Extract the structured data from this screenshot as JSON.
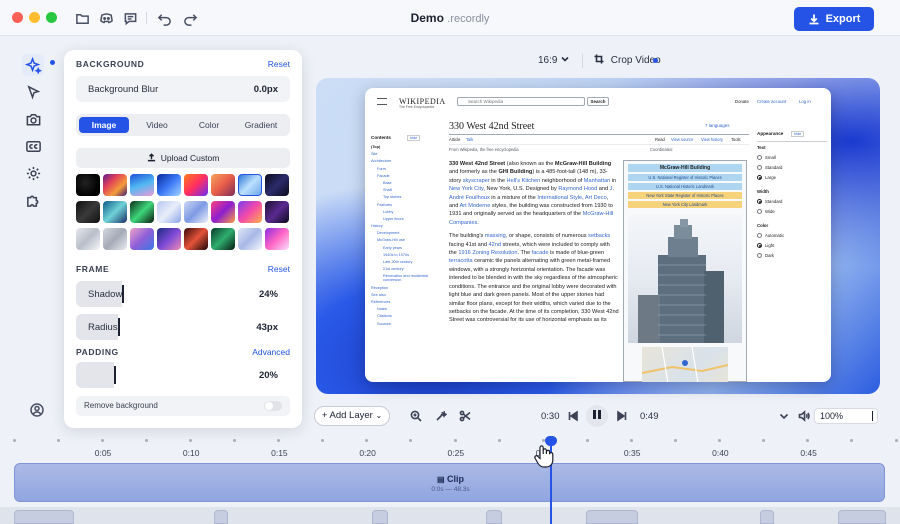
{
  "window": {
    "title": "Demo",
    "extension": ".recordly",
    "export_label": "Export"
  },
  "panel": {
    "background_section": "BACKGROUND",
    "background_reset": "Reset",
    "blur_label": "Background Blur",
    "blur_value": "0.0px",
    "tabs": [
      "Image",
      "Video",
      "Color",
      "Gradient"
    ],
    "active_tab": "Image",
    "upload_label": "Upload Custom",
    "frame_section": "FRAME",
    "frame_reset": "Reset",
    "shadow_label": "Shadow",
    "shadow_value": "24%",
    "shadow_level": 0.24,
    "radius_label": "Radius",
    "radius_value": "43px",
    "padding_section": "PADDING",
    "padding_advanced": "Advanced",
    "padding_value": "20%",
    "padding_level": 0.2,
    "remove_bg_label": "Remove background"
  },
  "canvas_toolbar": {
    "aspect_ratio": "16:9",
    "crop_label": "Crop Video"
  },
  "wiki": {
    "logo": "WIKIPEDIA",
    "tagline": "The Free Encyclopedia",
    "search_placeholder": "Search Wikipedia",
    "search_button": "Search",
    "top_links": [
      "Donate",
      "Create account",
      "Log in"
    ],
    "title": "330 West 42nd Street",
    "languages": "7 languages",
    "tabs": [
      "Article",
      "Talk"
    ],
    "actions": [
      "Read",
      "View source",
      "View history",
      "Tools"
    ],
    "from": "From Wikipedia, the free encyclopedia",
    "coordinates_label": "Coordinates:",
    "contents_title": "Contents",
    "contents_hide": "hide",
    "toc": [
      "(Top)",
      "Site",
      "Architecture",
      "Form",
      "Facade",
      "Base",
      "Shaft",
      "Top stories",
      "Features",
      "Lobby",
      "Upper floors",
      "History",
      "Development",
      "McGraw-Hill use",
      "Early years",
      "1940s to 1970s",
      "Late 20th century",
      "21st century",
      "Renovation and residential conversion",
      "Reception",
      "See also",
      "References",
      "Notes",
      "Citations",
      "Sources"
    ],
    "body_p1_a": "330 West 42nd Street",
    "body_p1_b": " (also known as the ",
    "body_p1_c": "McGraw-Hill Building",
    "body_p1_d": " and formerly as the ",
    "body_p1_e": "GHI Building",
    "body_p1_f": ") is a 485-foot-tall (148 m), 33-story ",
    "body_p1_g": "skyscraper",
    "body_p1_h": " in the ",
    "body_p1_i": "Hell's Kitchen",
    "body_p1_j": " neighborhood of ",
    "body_p1_k": "Manhattan",
    "body_p1_l": " in ",
    "body_p1_m": "New York City",
    "body_p1_n": ", New York, U.S. Designed by ",
    "body_p1_o": "Raymond Hood",
    "body_p1_p": " and ",
    "body_p1_q": "J. André Fouilhoux",
    "body_p1_r": " in a mixture of the ",
    "body_p1_s": "International Style",
    "body_p1_t": ", ",
    "body_p1_u": "Art Deco",
    "body_p1_v": ", and ",
    "body_p1_w": "Art Moderne",
    "body_p1_x": " styles, the building was constructed from 1930 to 1931 and originally served as the headquarters of the ",
    "body_p1_y": "McGraw-Hill Companies",
    "body_p1_z": ".",
    "body_p2_a": "The building's ",
    "body_p2_b": "massing",
    "body_p2_c": ", or shape, consists of numerous ",
    "body_p2_d": "setbacks",
    "body_p2_e": " facing 41st and ",
    "body_p2_f": "42nd",
    "body_p2_g": " streets, which were included to comply with the ",
    "body_p2_h": "1916 Zoning Resolution",
    "body_p2_i": ". The ",
    "body_p2_j": "facade",
    "body_p2_k": " is made of blue-green ",
    "body_p2_l": "terracotta",
    "body_p2_m": " ceramic tile panels alternating with green metal-framed windows, with a strongly horizontal orientation. The facade was intended to be blended in with the sky regardless of the atmospheric conditions. The entrance and the original lobby were decorated with light blue and dark green panels. Most of the upper stories had similar floor plans, except for their widths, which varied due to the setbacks on the facade. At the time of its completion, 330 West 42nd Street was controversial for its use of horizontal emphasis as its",
    "infobox_title": "McGraw-Hill Building",
    "infobox_rows": [
      "U.S. National Register of Historic Places",
      "U.S. National Historic Landmark",
      "New York State Register of Historic Places",
      "New York City Landmark"
    ],
    "appearance_title": "Appearance",
    "appearance_hide": "hide",
    "text_label": "Text",
    "text_options": [
      "Small",
      "Standard",
      "Large"
    ],
    "width_label": "Width",
    "width_options": [
      "Standard",
      "Wide"
    ],
    "color_label": "Color",
    "color_options": [
      "Automatic",
      "Light",
      "Dark"
    ]
  },
  "playback": {
    "add_layer": "Add Layer",
    "current_time": "0:30",
    "total_time": "0:49",
    "zoom": "100%"
  },
  "timeline": {
    "ruler": [
      "0:05",
      "0:10",
      "0:15",
      "0:20",
      "0:25",
      "0:30",
      "0:35",
      "0:40",
      "0:45"
    ],
    "clip_label": "Clip",
    "clip_sub": "0:0s — 48.3s"
  },
  "colors": {
    "accent": "#2453e6",
    "panel_bg": "#ffffff",
    "app_bg": "#eef1f7"
  }
}
